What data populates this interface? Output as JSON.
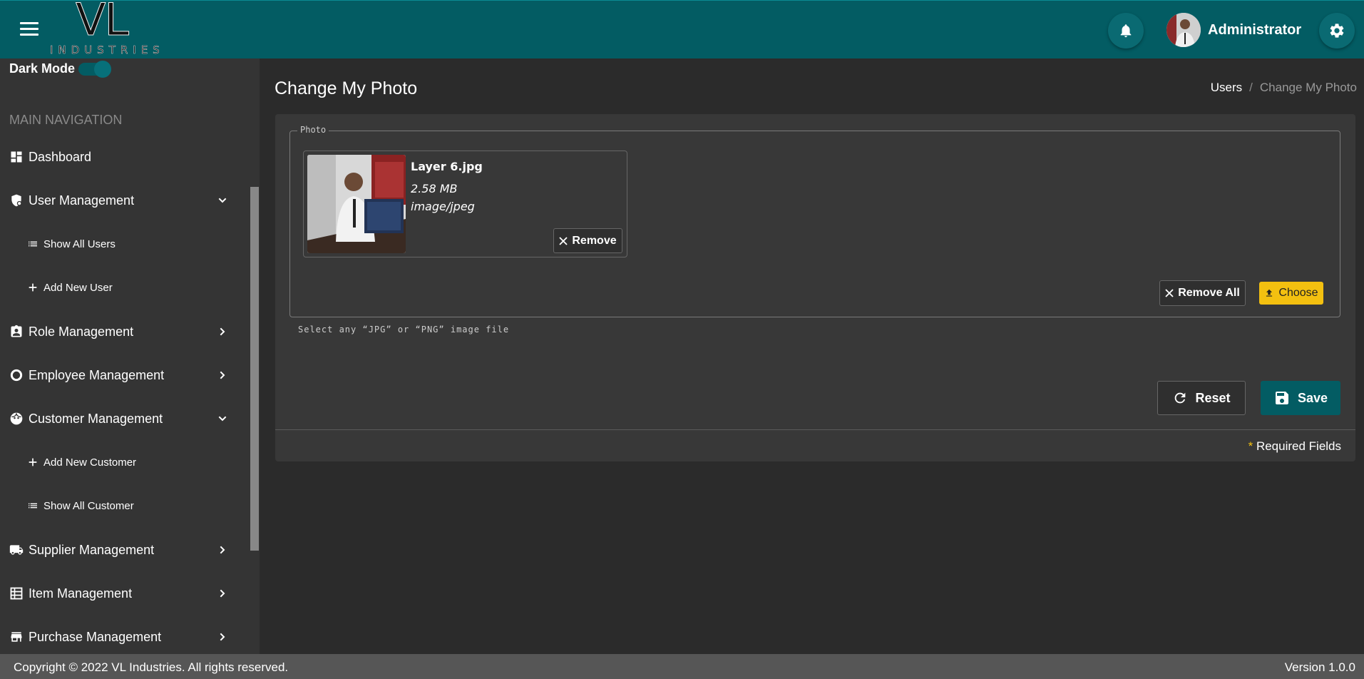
{
  "header": {
    "logo_main": "VL",
    "logo_sub": "INDUSTRIES",
    "user_name": "Administrator",
    "accent_color": "#035c63"
  },
  "sidebar": {
    "dark_mode_label": "Dark Mode",
    "dark_mode_on": true,
    "section_title": "MAIN NAVIGATION",
    "items": [
      {
        "label": "Dashboard",
        "icon": "dashboard-icon"
      },
      {
        "label": "User Management",
        "icon": "user-shield-icon",
        "expanded": true
      },
      {
        "label": "Show All Users",
        "icon": "list-icon"
      },
      {
        "label": "Add New User",
        "icon": "plus-icon"
      },
      {
        "label": "Role Management",
        "icon": "badge-icon",
        "expanded": false
      },
      {
        "label": "Employee Management",
        "icon": "circle-icon",
        "expanded": false
      },
      {
        "label": "Customer Management",
        "icon": "face-icon",
        "expanded": true
      },
      {
        "label": "Add New Customer",
        "icon": "plus-icon"
      },
      {
        "label": "Show All Customer",
        "icon": "list-icon"
      },
      {
        "label": "Supplier Management",
        "icon": "truck-icon",
        "expanded": false
      },
      {
        "label": "Item Management",
        "icon": "table-icon",
        "expanded": false
      },
      {
        "label": "Purchase Management",
        "icon": "store-icon",
        "expanded": false
      }
    ]
  },
  "main": {
    "page_title": "Change My Photo",
    "breadcrumb": {
      "link": "Users",
      "separator": "/",
      "current": "Change My Photo"
    },
    "photo_legend": "Photo",
    "file": {
      "name": "Layer 6.jpg",
      "size": "2.58 MB",
      "type": "image/jpeg"
    },
    "remove_label": "Remove",
    "remove_all_label": "Remove All",
    "choose_label": "Choose",
    "hint": "Select any “JPG” or “PNG” image file",
    "reset_label": "Reset",
    "save_label": "Save",
    "required_star": "*",
    "required_text": " Required Fields",
    "choose_color": "#f3c010"
  },
  "footer": {
    "copyright": "Copyright © 2022 VL Industries. All rights reserved.",
    "version": "Version 1.0.0"
  }
}
